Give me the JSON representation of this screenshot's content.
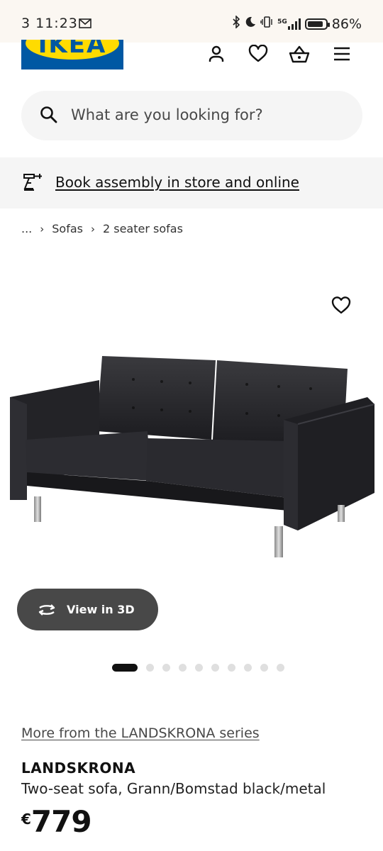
{
  "status_bar": {
    "time": "3 11:23",
    "network": "5G",
    "battery_percent": "86%",
    "battery_level": 0.86
  },
  "header": {
    "logo_text": "IKEA",
    "icons": [
      "account-icon",
      "favorites-icon",
      "basket-icon",
      "menu-icon"
    ]
  },
  "search": {
    "placeholder": "What are you looking for?"
  },
  "banner": {
    "text": "Book assembly in store and online"
  },
  "breadcrumb": {
    "ellipsis": "...",
    "items": [
      "Sofas",
      "2 seater sofas"
    ]
  },
  "gallery": {
    "view3d_label": "View in 3D",
    "slide_count": 10,
    "active_slide": 1
  },
  "product": {
    "series_link": "More from the LANDSKRONA series",
    "name": "LANDSKRONA",
    "description": "Two-seat sofa, Grann/Bomstad black/metal",
    "currency": "€",
    "price": "779"
  },
  "colors": {
    "ikea_blue": "#0058a3",
    "ikea_yellow": "#ffdb00",
    "search_bg": "#f5f5f5",
    "button_dark": "#484848"
  }
}
